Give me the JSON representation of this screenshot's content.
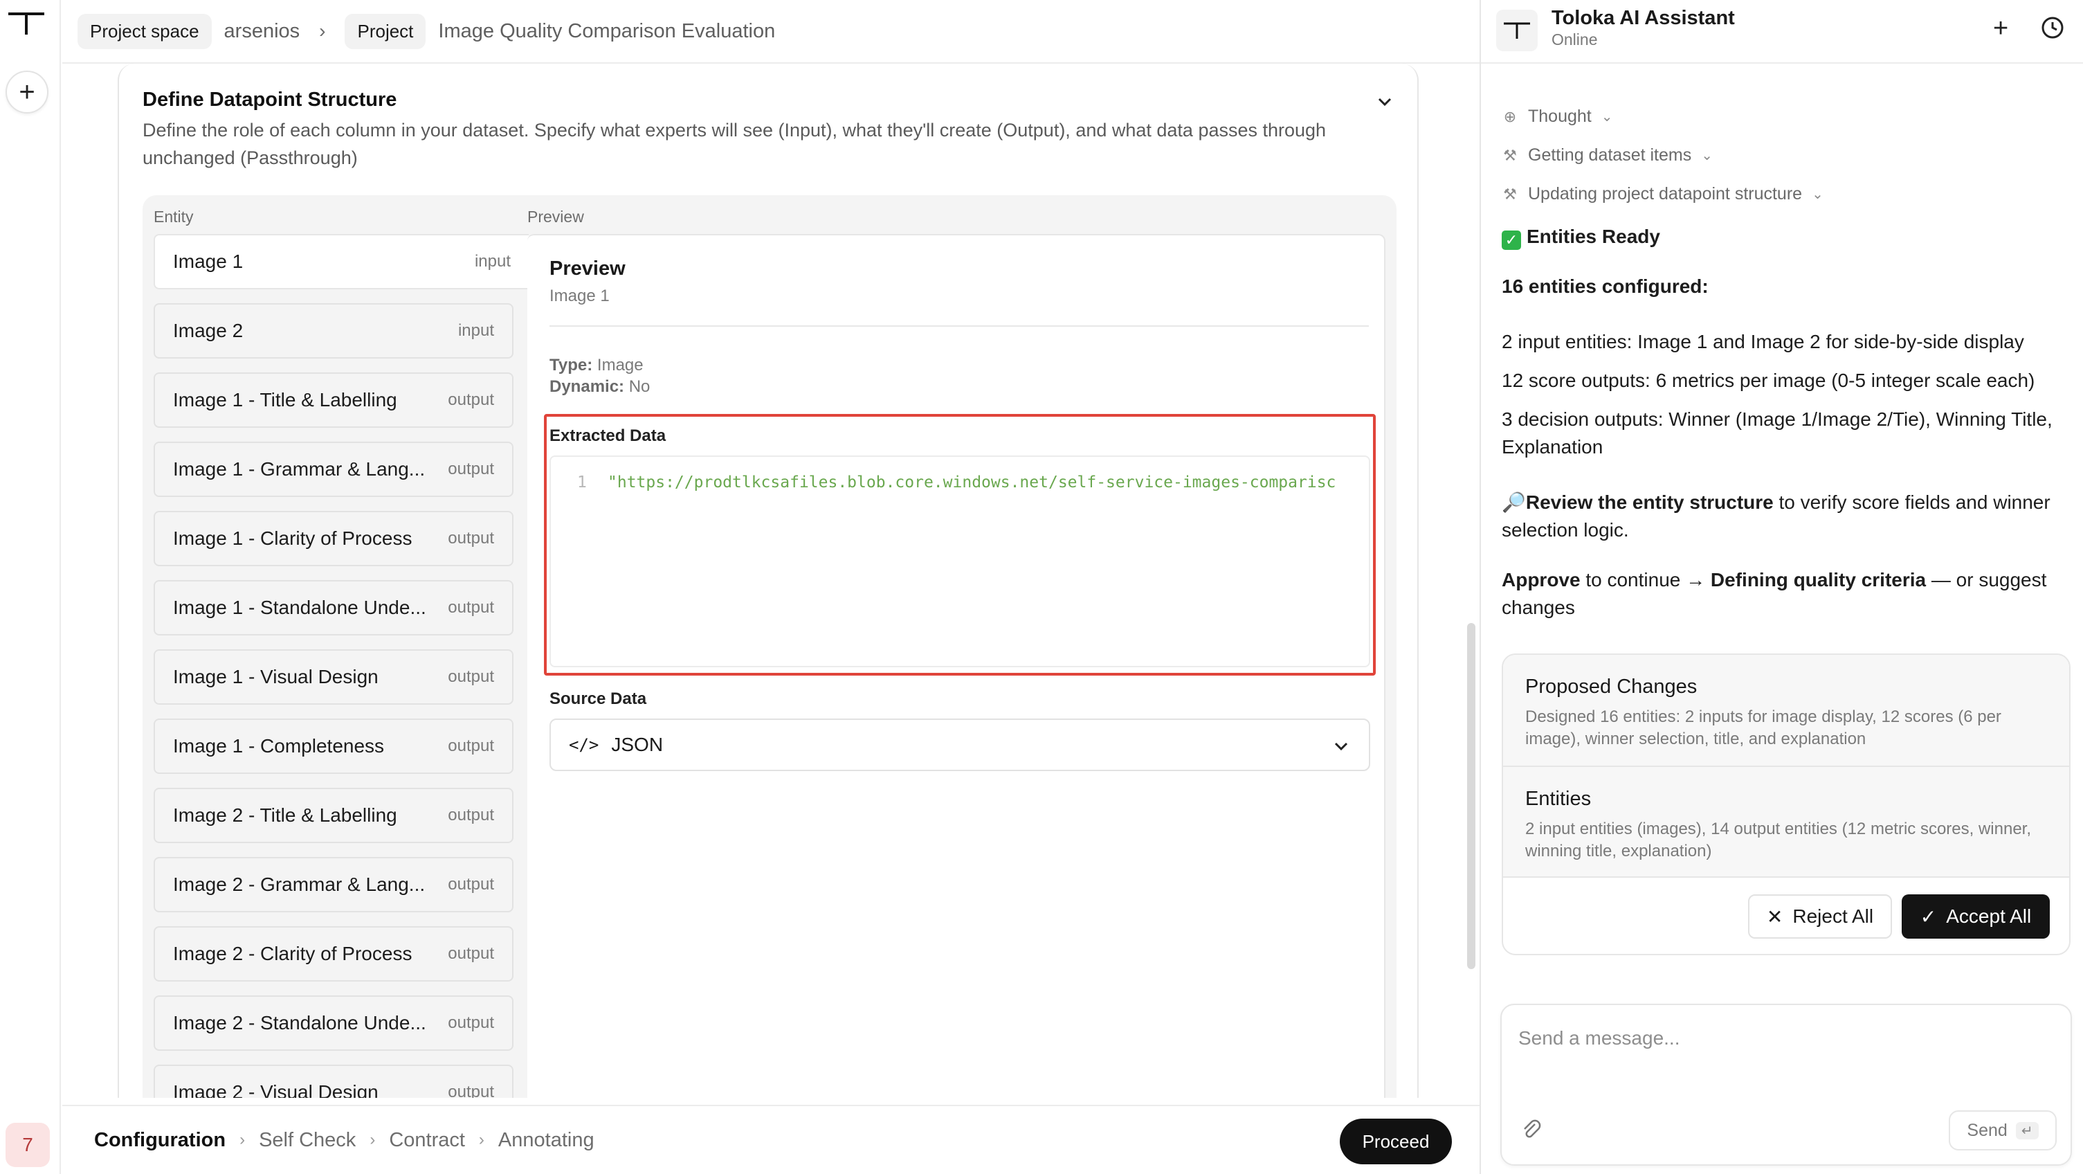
{
  "topbar": {
    "chip_project_space": "Project space",
    "workspace": "arsenios",
    "chip_project": "Project",
    "project_name": "Image Quality Comparison Evaluation"
  },
  "rail": {
    "avatar_number": "7"
  },
  "card": {
    "title": "Define Datapoint Structure",
    "description": "Define the role of each column in your dataset. Specify what experts will see (Input), what they'll create (Output), and what data passes through unchanged (Passthrough)",
    "col_entity": "Entity",
    "col_preview": "Preview"
  },
  "entities": [
    {
      "name": "Image 1",
      "role": "input"
    },
    {
      "name": "Image 2",
      "role": "input"
    },
    {
      "name": "Image 1 - Title & Labelling",
      "role": "output"
    },
    {
      "name": "Image 1 - Grammar & Lang...",
      "role": "output"
    },
    {
      "name": "Image 1 - Clarity of Process",
      "role": "output"
    },
    {
      "name": "Image 1 - Standalone Unde...",
      "role": "output"
    },
    {
      "name": "Image 1 - Visual Design",
      "role": "output"
    },
    {
      "name": "Image 1 - Completeness",
      "role": "output"
    },
    {
      "name": "Image 2 - Title & Labelling",
      "role": "output"
    },
    {
      "name": "Image 2 - Grammar & Lang...",
      "role": "output"
    },
    {
      "name": "Image 2 - Clarity of Process",
      "role": "output"
    },
    {
      "name": "Image 2 - Standalone Unde...",
      "role": "output"
    },
    {
      "name": "Image 2 - Visual Design",
      "role": "output"
    }
  ],
  "preview": {
    "title": "Preview",
    "subtitle": "Image 1",
    "type_label": "Type:",
    "type_value": "Image",
    "dynamic_label": "Dynamic:",
    "dynamic_value": "No",
    "extracted_label": "Extracted Data",
    "code_line_number": "1",
    "code_value": "\"https://prodtlkcsafiles.blob.core.windows.net/self-service-images-comparisc",
    "source_label": "Source Data",
    "source_value": "JSON"
  },
  "bottombar": {
    "steps": [
      "Configuration",
      "Self Check",
      "Contract",
      "Annotating"
    ],
    "proceed": "Proceed"
  },
  "assistant": {
    "name": "Toloka AI Assistant",
    "status": "Online",
    "tool_steps": [
      "Thought",
      "Getting dataset items",
      "Updating project datapoint structure"
    ],
    "entities_ready": "Entities Ready",
    "configured": "16 entities configured:",
    "line_inputs": "2 input entities: Image 1 and Image 2 for side-by-side display",
    "line_scores": "12 score outputs: 6 metrics per image (0-5 integer scale each)",
    "line_decision": "3 decision outputs: Winner (Image 1/Image 2/Tie), Winning Title, Explanation",
    "review_bold": "Review the entity structure",
    "review_rest": " to verify score fields and winner selection logic.",
    "approve_bold": "Approve",
    "approve_mid": " to continue → ",
    "approve_bold2": "Defining quality criteria",
    "approve_rest": " — or suggest changes",
    "proposed_title": "Proposed Changes",
    "proposed_body": "Designed 16 entities: 2 inputs for image display, 12 scores (6 per image), winner selection, title, and explanation",
    "entities_title": "Entities",
    "entities_body": "2 input entities (images), 14 output entities (12 metric scores, winner, winning title, explanation)",
    "reject_all": "Reject All",
    "accept_all": "Accept All",
    "composer_placeholder": "Send a message...",
    "send": "Send"
  }
}
